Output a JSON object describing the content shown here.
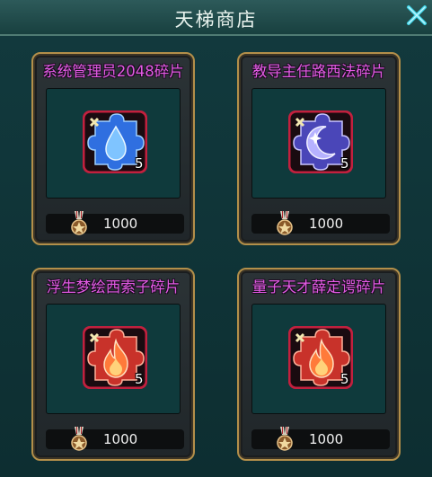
{
  "window": {
    "title": "天梯商店"
  },
  "items": [
    {
      "name": "系统管理员2048碎片",
      "count": "5",
      "price": "1000",
      "element": "water-drop-icon",
      "color": "#2f6fe0"
    },
    {
      "name": "教导主任路西法碎片",
      "count": "5",
      "price": "1000",
      "element": "crescent-moon-icon",
      "color": "#4a46b8"
    },
    {
      "name": "浮生梦绘西索子碎片",
      "count": "5",
      "price": "1000",
      "element": "flame-icon",
      "color": "#c8322a"
    },
    {
      "name": "量子天才薛定谔碎片",
      "count": "5",
      "price": "1000",
      "element": "flame-icon",
      "color": "#c8322a"
    }
  ],
  "currency": {
    "icon": "medal-icon"
  },
  "colors": {
    "title_accent": "#e25ae3",
    "card_border": "#b38f4a"
  }
}
